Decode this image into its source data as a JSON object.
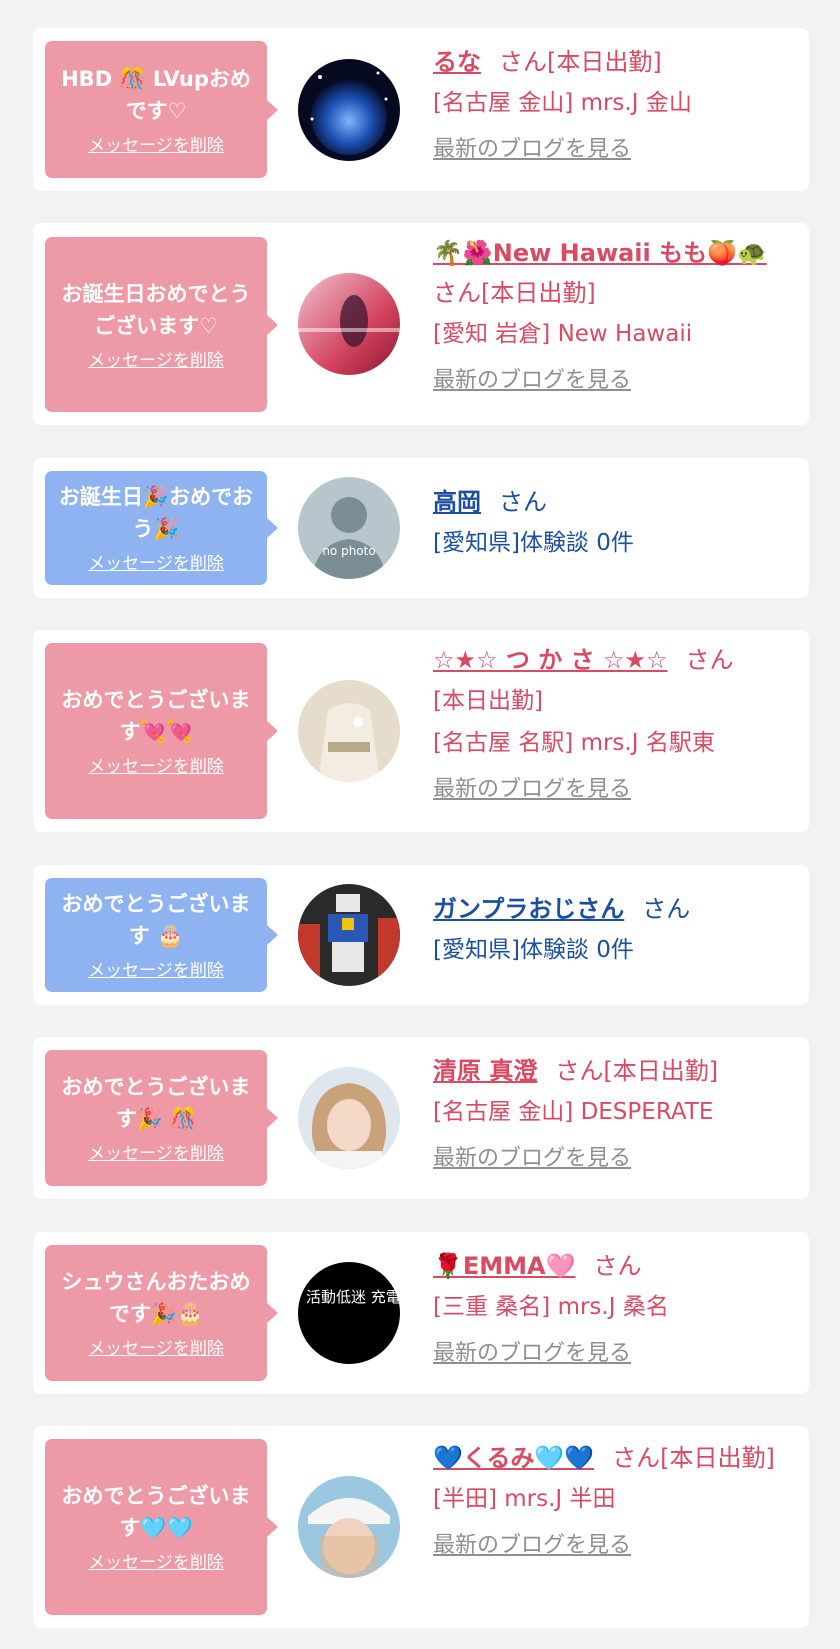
{
  "common": {
    "delete_label": "メッセージを削除",
    "blog_label": "最新のブログを見る",
    "san": "さん"
  },
  "cards": [
    {
      "theme": "pink",
      "message": "HBD 🎊 LVupおめです♡",
      "name": "るな",
      "suffix": "[本日出勤]",
      "meta": [
        "[名古屋 金山] mrs.J 金山"
      ],
      "has_blog": true
    },
    {
      "theme": "pink",
      "message": "お誕生日おめでとうございます♡",
      "name": "🌴🌺New Hawaii もも🍑🐢",
      "suffix": "[本日出勤]",
      "meta": [
        "[愛知 岩倉] New Hawaii"
      ],
      "has_blog": true
    },
    {
      "theme": "blue",
      "message": "お誕生日🎉おめでおう🎉",
      "name": "高岡",
      "suffix": "",
      "meta": [
        "[愛知県]体験談 0件"
      ],
      "has_blog": false,
      "avatar_text": "no photo"
    },
    {
      "theme": "pink",
      "message": "おめでとうございます💘💘",
      "name": "☆★☆ つ か さ ☆★☆",
      "suffix": "",
      "meta": [
        "[本日出勤]",
        "[名古屋 名駅] mrs.J 名駅東"
      ],
      "has_blog": true
    },
    {
      "theme": "blue",
      "message": "おめでとうございます 🎂",
      "name": "ガンプラおじさん",
      "suffix": "",
      "meta": [
        "[愛知県]体験談 0件"
      ],
      "has_blog": false
    },
    {
      "theme": "pink",
      "message": "おめでとうございます🎉 🎊",
      "name": "清原 真澄",
      "suffix": "[本日出勤]",
      "meta": [
        "[名古屋 金山] DESPERATE"
      ],
      "has_blog": true
    },
    {
      "theme": "pink",
      "message": "シュウさんおたおめです🎉🎂",
      "name": "🌹EMMA🩷",
      "suffix": "",
      "meta": [
        "[三重 桑名] mrs.J 桑名"
      ],
      "has_blog": true,
      "avatar_text": "活動低迷 充電中。"
    },
    {
      "theme": "pink",
      "message": "おめでとうございます🩵🩵",
      "name": "💙くるみ🩵💙",
      "suffix": "[本日出勤]",
      "meta": [
        "[半田] mrs.J 半田"
      ],
      "has_blog": true
    }
  ]
}
